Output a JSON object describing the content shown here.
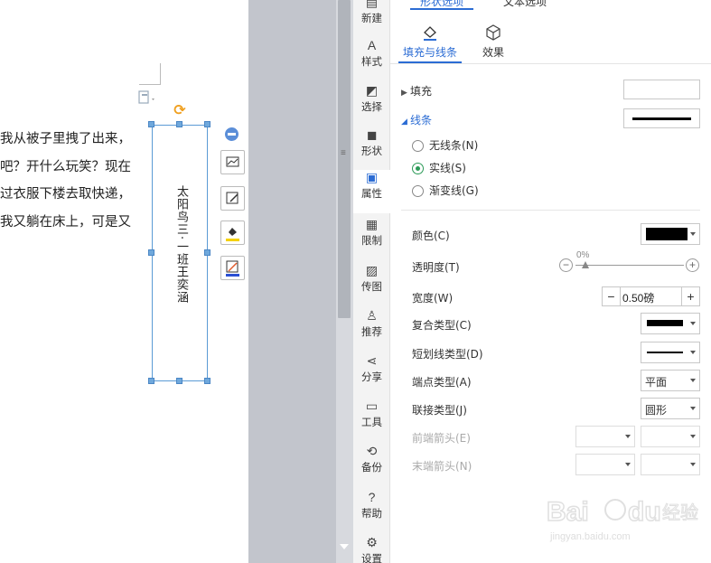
{
  "document": {
    "lines": [
      "我从被子里拽了出来，",
      "吧？开什么玩笑？现在",
      "过衣服下楼去取快递，",
      "我又躺在床上，可是又"
    ],
    "textbox_text": "太阳鸟三·一班王奕涵"
  },
  "strip": {
    "items": [
      {
        "label": "新建",
        "icon": "new-icon"
      },
      {
        "label": "样式",
        "icon": "style-icon"
      },
      {
        "label": "选择",
        "icon": "select-icon"
      },
      {
        "label": "形状",
        "icon": "shape-icon"
      },
      {
        "label": "属性",
        "icon": "property-icon"
      },
      {
        "label": "限制",
        "icon": "restrict-icon"
      },
      {
        "label": "传图",
        "icon": "upload-image-icon"
      },
      {
        "label": "推荐",
        "icon": "recommend-icon"
      },
      {
        "label": "分享",
        "icon": "share-icon"
      },
      {
        "label": "工具",
        "icon": "toolbox-icon"
      },
      {
        "label": "备份",
        "icon": "backup-icon"
      },
      {
        "label": "帮助",
        "icon": "help-icon"
      },
      {
        "label": "设置",
        "icon": "gear-icon"
      }
    ],
    "active": "属性"
  },
  "panel": {
    "top_tabs": [
      "形状选项",
      "文本选项"
    ],
    "sub_tabs": [
      "填充与线条",
      "效果"
    ],
    "fill_label": "填充",
    "line_label": "线条",
    "radios": [
      "无线条(N)",
      "实线(S)",
      "渐变线(G)"
    ],
    "selected_radio": "实线(S)",
    "props": {
      "color": "颜色(C)",
      "transparency": "透明度(T)",
      "width": "宽度(W)",
      "compound": "复合类型(C)",
      "dash": "短划线类型(D)",
      "cap": "端点类型(A)",
      "join": "联接类型(J)",
      "begin_arrow": "前端箭头(E)",
      "end_arrow": "末端箭头(N)"
    },
    "transparency_value": "0%",
    "width_value": "0.50磅",
    "cap_value": "平面",
    "join_value": "圆形",
    "line_color": "#000000",
    "accent": "#2b6cd4"
  },
  "watermark": {
    "url": "jingyan.baidu.com"
  }
}
